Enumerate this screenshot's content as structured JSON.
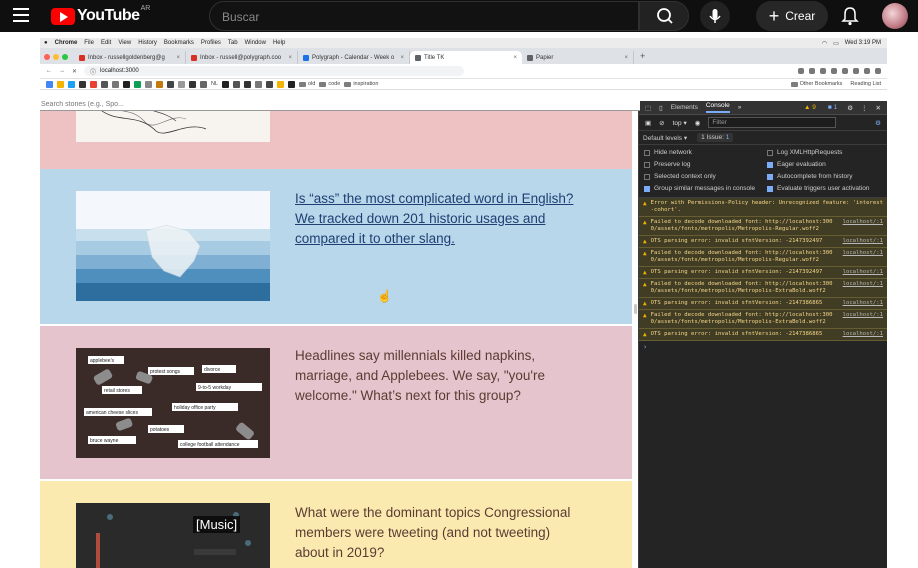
{
  "youtube": {
    "logo_text": "YouTube",
    "region": "AR",
    "search_placeholder": "Buscar",
    "create_label": "Crear"
  },
  "mac_menubar": {
    "app": "Chrome",
    "items": [
      "File",
      "Edit",
      "View",
      "History",
      "Bookmarks",
      "Profiles",
      "Tab",
      "Window",
      "Help"
    ],
    "clock": "Wed 3:19 PM"
  },
  "browser": {
    "tabs": [
      {
        "label": "Inbox - russellgoldenberg@g",
        "color": "#d93025"
      },
      {
        "label": "Inbox - russell@polygraph.coo",
        "color": "#d93025"
      },
      {
        "label": "Polygraph - Calendar - Week o",
        "color": "#1a73e8"
      },
      {
        "label": "Title TK",
        "color": "#5f6368"
      },
      {
        "label": "Papier",
        "color": "#5f6368"
      }
    ],
    "url": "localhost:3000",
    "bookmarks": {
      "items": [
        "NL",
        "old",
        "code",
        "inspiration"
      ],
      "other": "Other Bookmarks",
      "reading": "Reading List"
    }
  },
  "page": {
    "search_placeholder": "Search stories (e.g., Spo...",
    "stories": [
      {
        "headline": "Is “ass” the most complicated word in English? We tracked down 201 historic usages and compared it to other slang."
      },
      {
        "headline": "Headlines say millennials killed napkins, marriage, and Applebees. We say, \"you're welcome.\" What’s next for this group?",
        "tags": [
          "applebee's",
          "protest songs",
          "divorce",
          "retail stores",
          "9-to-5 workday",
          "american cheese slices",
          "holiday office party",
          "bruce wayne",
          "potatoes",
          "college football attendance"
        ]
      },
      {
        "headline": "What were the dominant topics Congressional members were tweeting (and not tweeting) about in 2019?"
      }
    ]
  },
  "devtools": {
    "tabs": [
      "Elements",
      "Console"
    ],
    "warn_count": "9",
    "info_count": "1",
    "context": "top",
    "filter_placeholder": "Filter",
    "levels": "Default levels",
    "issues": "1 Issue:",
    "issue_count": "1",
    "settings": [
      {
        "label": "Hide network",
        "checked": false
      },
      {
        "label": "Log XMLHttpRequests",
        "checked": false
      },
      {
        "label": "Preserve log",
        "checked": false
      },
      {
        "label": "Eager evaluation",
        "checked": true
      },
      {
        "label": "Selected context only",
        "checked": false
      },
      {
        "label": "Autocomplete from history",
        "checked": true
      },
      {
        "label": "Group similar messages in console",
        "checked": true
      },
      {
        "label": "Evaluate triggers user activation",
        "checked": true
      }
    ],
    "messages": [
      {
        "text": "Error with Permissions-Policy header: Unrecognized feature: 'interest-cohort'.",
        "src": ""
      },
      {
        "text": "Failed to decode downloaded font: http://localhost:3000/assets/fonts/metropolis/Metropolis-Regular.woff2",
        "src": "localhost/:1"
      },
      {
        "text": "OTS parsing error: invalid sfntVersion: -2147392497",
        "src": "localhost/:1"
      },
      {
        "text": "Failed to decode downloaded font: http://localhost:3000/assets/fonts/metropolis/Metropolis-Regular.woff2",
        "src": "localhost/:1"
      },
      {
        "text": "OTS parsing error: invalid sfntVersion: -2147392497",
        "src": "localhost/:1"
      },
      {
        "text": "Failed to decode downloaded font: http://localhost:3000/assets/fonts/metropolis/Metropolis-ExtraBold.woff2",
        "src": "localhost/:1"
      },
      {
        "text": "OTS parsing error: invalid sfntVersion: -2147386865",
        "src": "localhost/:1"
      },
      {
        "text": "Failed to decode downloaded font: http://localhost:3000/assets/fonts/metropolis/Metropolis-ExtraBold.woff2",
        "src": "localhost/:1"
      },
      {
        "text": "OTS parsing error: invalid sfntVersion: -2147386865",
        "src": "localhost/:1"
      }
    ]
  },
  "caption": "[Music]"
}
